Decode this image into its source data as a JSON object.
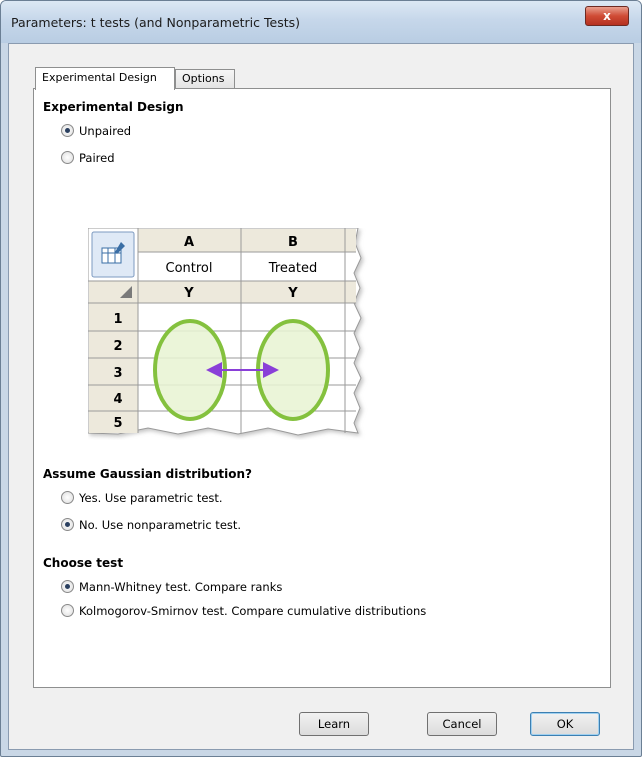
{
  "window": {
    "title": "Parameters: t tests (and Nonparametric Tests)",
    "close_label": "x"
  },
  "tabs": [
    {
      "label": "Experimental Design",
      "active": true
    },
    {
      "label": "Options",
      "active": false
    }
  ],
  "experimental_design": {
    "heading": "Experimental Design",
    "options": [
      {
        "label": "Unpaired",
        "checked": true
      },
      {
        "label": "Paired",
        "checked": false
      }
    ]
  },
  "table_illustration": {
    "columns": [
      {
        "letter": "A",
        "title": "Control",
        "subheader": "Y"
      },
      {
        "letter": "B",
        "title": "Treated",
        "subheader": "Y"
      }
    ],
    "rows": [
      "1",
      "2",
      "3",
      "4",
      "5"
    ],
    "icon": "table-format-icon",
    "colors": {
      "oval_stroke": "#84c13e",
      "oval_fill": "#e7f3d2",
      "arrow": "#8a3fd8",
      "header_bg": "#ede9dc"
    }
  },
  "gaussian": {
    "heading": "Assume Gaussian distribution?",
    "options": [
      {
        "label": "Yes. Use parametric test.",
        "checked": false
      },
      {
        "label": "No. Use nonparametric test.",
        "checked": true
      }
    ]
  },
  "choose_test": {
    "heading": "Choose test",
    "options": [
      {
        "label": "Mann-Whitney test. Compare ranks",
        "checked": true
      },
      {
        "label": "Kolmogorov-Smirnov test. Compare cumulative distributions",
        "checked": false
      }
    ]
  },
  "buttons": {
    "learn": "Learn",
    "cancel": "Cancel",
    "ok": "OK"
  }
}
